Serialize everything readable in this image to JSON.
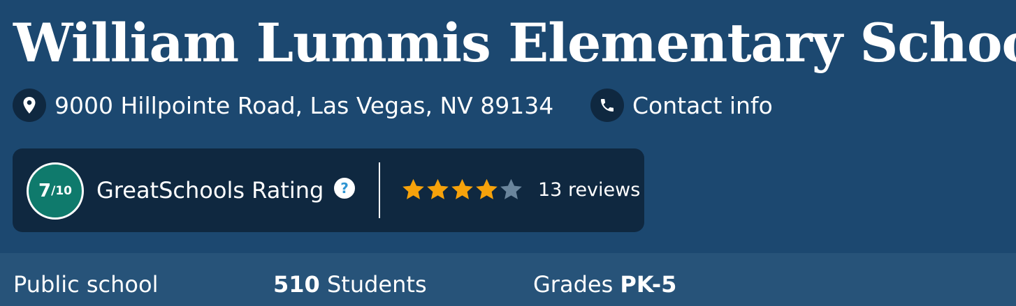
{
  "school": {
    "name": "William Lummis Elementary School",
    "address": "9000 Hillpointe Road, Las Vegas, NV 89134",
    "contact_label": "Contact info"
  },
  "rating": {
    "value": "7",
    "out_of": "/10",
    "label": "GreatSchools Rating",
    "help_glyph": "?",
    "stars_filled": 4,
    "stars_total": 5,
    "reviews_label": "13 reviews"
  },
  "stats": {
    "type": "Public school",
    "students_count": "510",
    "students_label": " Students",
    "grades_label": "Grades ",
    "grades_value": "PK-5"
  },
  "icons": {
    "location": "location-pin-icon",
    "phone": "phone-icon",
    "help": "question-circle-icon",
    "star": "star-icon"
  },
  "colors": {
    "header_bg": "#1c4870",
    "card_bg": "#0f2840",
    "rating_green": "#0f7a6c",
    "star_filled": "#f6a20b",
    "star_empty": "#6a859c",
    "stats_bg": "#275379",
    "help_blue": "#2f95d3"
  }
}
